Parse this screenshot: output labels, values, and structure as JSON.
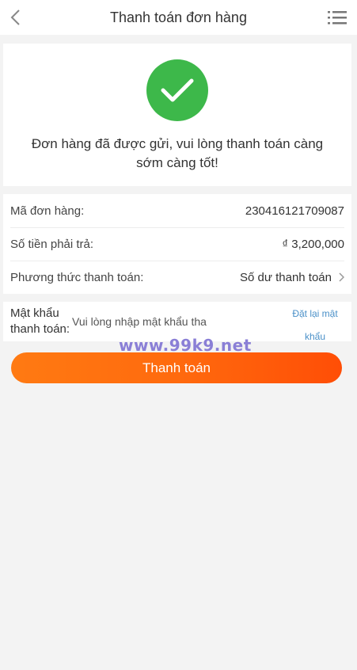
{
  "header": {
    "title": "Thanh toán đơn hàng",
    "back_icon": "chevron-left-icon",
    "menu_icon": "list-menu-icon"
  },
  "success": {
    "icon": "checkmark-circle-icon",
    "icon_color": "#3db84a",
    "message": "Đơn hàng đã được gửi, vui lòng thanh toán càng sớm càng tốt!"
  },
  "order": {
    "id_label": "Mã đơn hàng:",
    "id_value": "230416121709087",
    "amount_label": "Số tiền phải trả:",
    "amount_value": "₫ 3,200,000",
    "method_label": "Phương thức thanh toán:",
    "method_value": "Số dư thanh toán"
  },
  "password": {
    "label": "Mật khẩu thanh toán:",
    "placeholder": "Vui lòng nhập mật khẩu tha",
    "reset_link": "Đặt lại mật khẩu"
  },
  "watermark": "www.99k9.net",
  "pay_button": {
    "label": "Thanh toán",
    "color": "#ff6a0e"
  }
}
